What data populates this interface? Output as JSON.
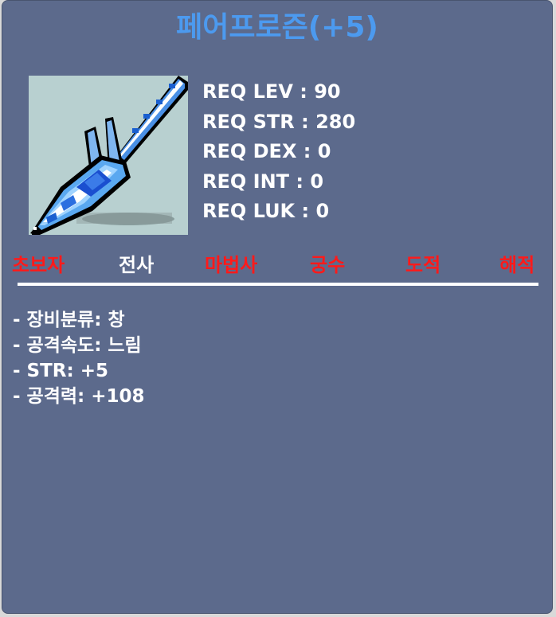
{
  "item": {
    "name": "페어프로즌(+5)",
    "icon": "frozen-spear-icon",
    "name_color": "#4c9aef"
  },
  "requirements": [
    {
      "label": "REQ LEV",
      "value": "90"
    },
    {
      "label": "REQ STR",
      "value": "280"
    },
    {
      "label": "REQ DEX",
      "value": "0"
    },
    {
      "label": "REQ INT",
      "value": "0"
    },
    {
      "label": "REQ LUK",
      "value": "0"
    }
  ],
  "jobs": [
    {
      "name": "초보자",
      "allowed": false
    },
    {
      "name": "전사",
      "allowed": true
    },
    {
      "name": "마법사",
      "allowed": false
    },
    {
      "name": "궁수",
      "allowed": false
    },
    {
      "name": "도적",
      "allowed": false
    },
    {
      "name": "해적",
      "allowed": false
    }
  ],
  "colors": {
    "background": "#5c6a8c",
    "allowed_job": "#ffffff",
    "disallowed_job": "#ff1a1a"
  },
  "stats": [
    "- 장비분류: 창",
    "- 공격속도: 느림",
    "- STR: +5",
    "- 공격력: +108"
  ]
}
